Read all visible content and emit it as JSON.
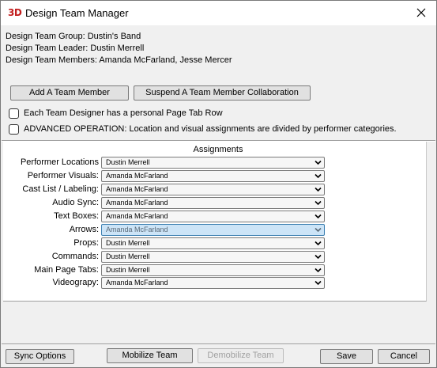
{
  "window": {
    "logo": "3D",
    "title": "Design Team Manager"
  },
  "info": {
    "group": "Design Team Group: Dustin's Band",
    "leader": "Design Team Leader: Dustin Merrell",
    "members": "Design Team Members: Amanda McFarland, Jesse Mercer"
  },
  "actions": {
    "add_member": "Add A Team Member",
    "suspend_member": "Suspend A Team Member Collaboration"
  },
  "options": {
    "personal_tab_row": {
      "label": "Each Team Designer has a personal Page Tab Row",
      "checked": false
    },
    "advanced": {
      "label": "ADVANCED OPERATION: Location and visual assignments are divided by performer categories.",
      "checked": false
    }
  },
  "assignments": {
    "title": "Assignments",
    "rows": [
      {
        "label": "Performer Locations",
        "value": "Dustin Merrell",
        "highlighted": false
      },
      {
        "label": "Performer Visuals:",
        "value": "Amanda McFarland",
        "highlighted": false
      },
      {
        "label": "Cast List / Labeling:",
        "value": "Amanda McFarland",
        "highlighted": false
      },
      {
        "label": "Audio Sync:",
        "value": "Amanda McFarland",
        "highlighted": false
      },
      {
        "label": "Text Boxes:",
        "value": "Amanda McFarland",
        "highlighted": false
      },
      {
        "label": "Arrows:",
        "value": "Amanda McFarland",
        "highlighted": true
      },
      {
        "label": "Props:",
        "value": "Dustin Merrell",
        "highlighted": false
      },
      {
        "label": "Commands:",
        "value": "Dustin Merrell",
        "highlighted": false
      },
      {
        "label": "Main Page Tabs:",
        "value": "Dustin Merrell",
        "highlighted": false
      },
      {
        "label": "Videograpy:",
        "value": "Amanda McFarland",
        "highlighted": false
      }
    ]
  },
  "footer": {
    "sync_options": "Sync Options",
    "mobilize": "Mobilize Team",
    "demobilize": "Demobilize Team",
    "save": "Save",
    "cancel": "Cancel"
  },
  "icons": {
    "close": "close-icon",
    "dropdown": "chevron-down-icon"
  },
  "colors": {
    "logo": "#c21e1e",
    "highlight": "#cce4f7"
  }
}
